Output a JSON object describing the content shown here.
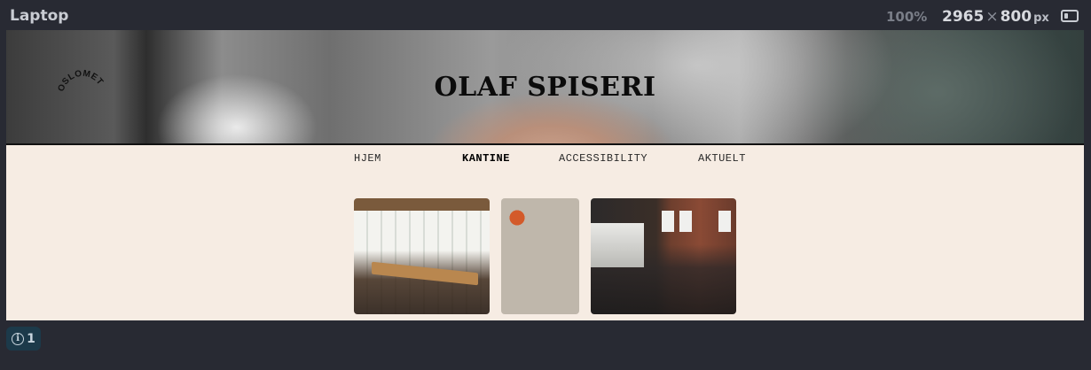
{
  "toolbar": {
    "device_name": "Laptop",
    "zoom": "100%",
    "width": "2965",
    "times": "×",
    "height": "800",
    "unit": "px",
    "rotate_icon": "rotate-device-icon"
  },
  "site": {
    "logo_text": "OSLOMET",
    "title": "OLAF SPISERI",
    "nav": [
      {
        "label": "HJEM",
        "active": false
      },
      {
        "label": "KANTINE",
        "active": true
      },
      {
        "label": "ACCESSIBILITY",
        "active": false
      },
      {
        "label": "AKTUELT",
        "active": false
      }
    ]
  },
  "status": {
    "info_icon": "i",
    "issue_count": "1"
  },
  "colors": {
    "frame": "#282a33",
    "page_bg": "#f6ece3",
    "badge_bg": "#1c3a4a"
  }
}
